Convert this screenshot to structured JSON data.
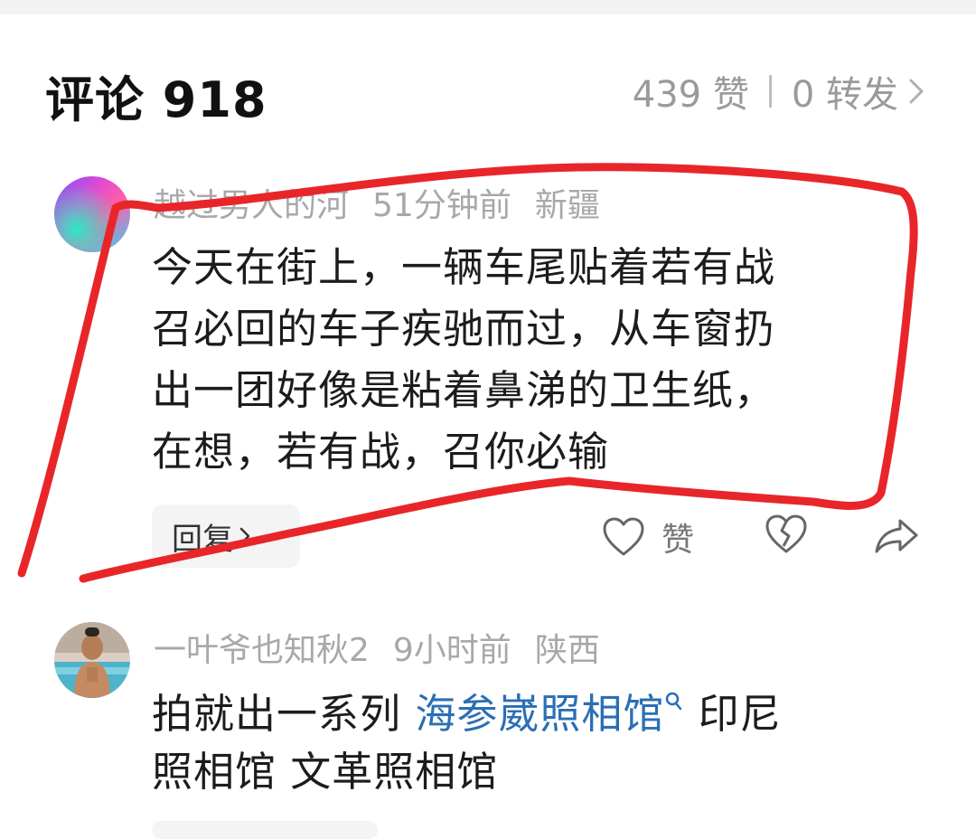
{
  "header": {
    "title": "评论 918",
    "likes": "439 赞",
    "forwards": "0 转发"
  },
  "comments": [
    {
      "username": "越过男人的河",
      "time": "51分钟前",
      "location": "新疆",
      "lines": [
        "今天在街上，一辆车尾贴着若有战",
        "召必回的车子疾驰而过，从车窗扔",
        "出一团好像是粘着鼻涕的卫生纸，",
        "在想，若有战，召你必输"
      ],
      "reply_label": "回复",
      "like_label": "赞"
    },
    {
      "username": "一叶爷也知秋2",
      "time": "9小时前",
      "location": "陕西",
      "text_before": "拍就出一系列 ",
      "link_text": "海参崴照相馆",
      "text_after": " 印尼",
      "line2": "照相馆 文革照相馆"
    }
  ],
  "colors": {
    "annotation": "#e8262a",
    "link": "#2a6fb5",
    "meta": "#a8a8a8"
  },
  "icons": {
    "like": "heart-outline-icon",
    "dislike": "broken-heart-icon",
    "share": "share-arrow-icon",
    "chevron": "chevron-right-icon",
    "search": "search-icon"
  }
}
